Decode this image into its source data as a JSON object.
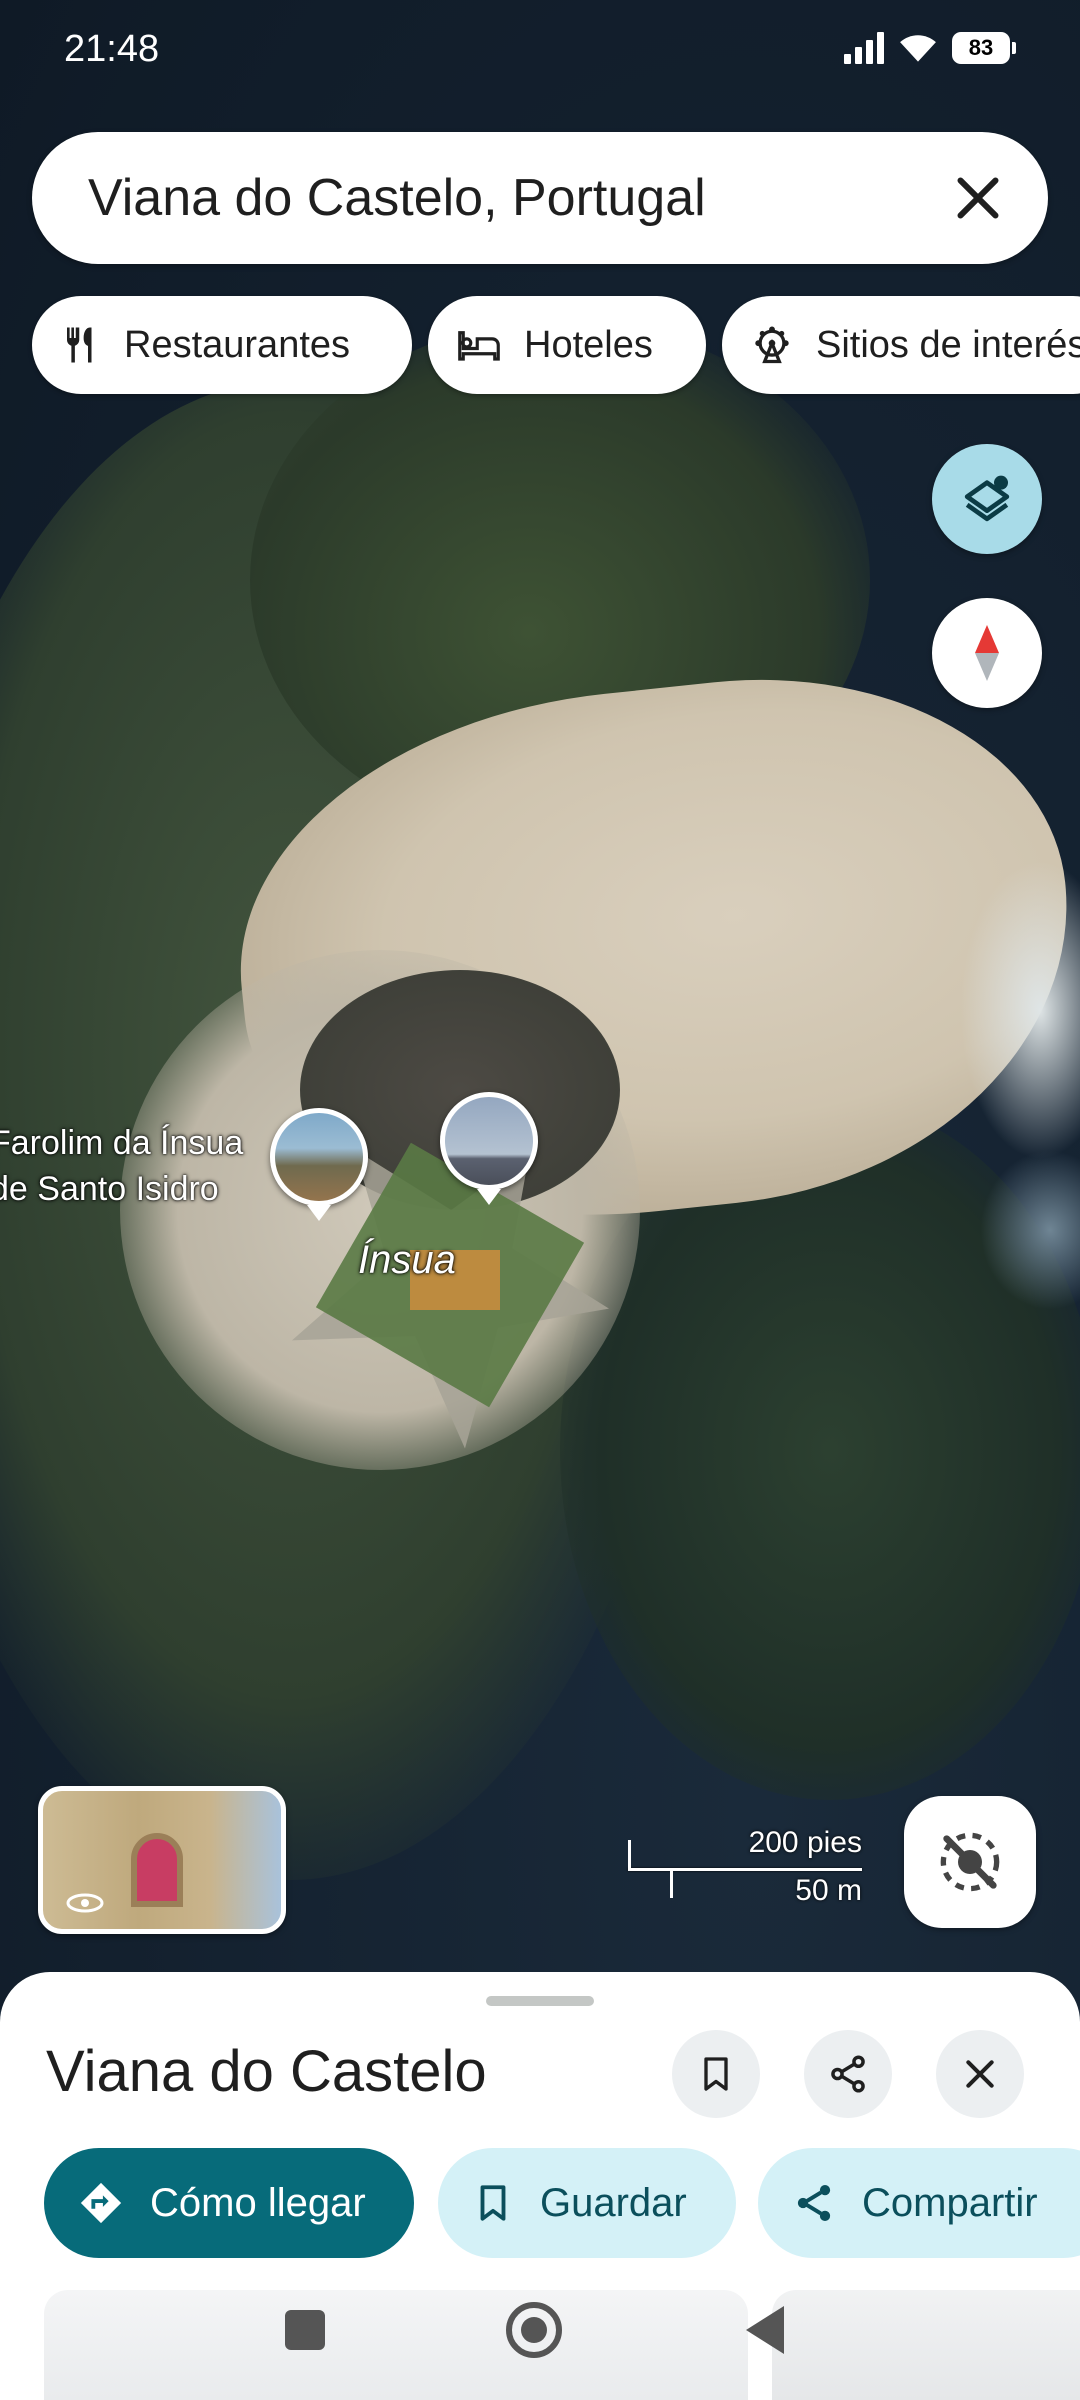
{
  "status_bar": {
    "time": "21:48",
    "battery": "83"
  },
  "search": {
    "query": "Viana do Castelo, Portugal"
  },
  "chips": [
    {
      "label": "Restaurantes",
      "icon": "fork-knife-icon"
    },
    {
      "label": "Hoteles",
      "icon": "bed-icon"
    },
    {
      "label": "Sitios de interés",
      "icon": "ferris-wheel-icon"
    }
  ],
  "map": {
    "place_label_line1": "Farolim da Ínsua",
    "place_label_line2": "de Santo Isidro",
    "island_label": "Ínsua",
    "scale_ft": "200 pies",
    "scale_m": "50 m"
  },
  "sheet": {
    "title": "Viana do Castelo",
    "actions": {
      "directions": "Cómo llegar",
      "save": "Guardar",
      "share": "Compartir"
    }
  },
  "colors": {
    "accent": "#076b7a",
    "accent_light": "#d4f1f7",
    "layers_button": "#a8dbe8",
    "compass_red": "#e53935"
  }
}
